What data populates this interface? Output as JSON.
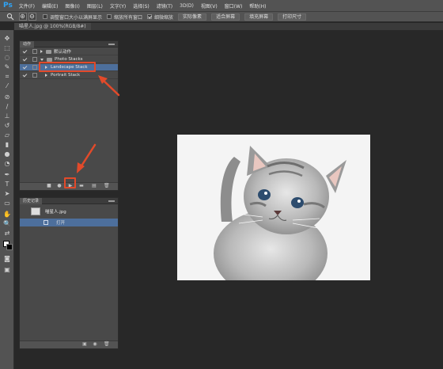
{
  "app": {
    "logo": "Ps"
  },
  "menu": [
    "文件(F)",
    "编辑(E)",
    "图像(I)",
    "图层(L)",
    "文字(Y)",
    "选择(S)",
    "滤镜(T)",
    "3D(D)",
    "视图(V)",
    "窗口(W)",
    "帮助(H)"
  ],
  "options": {
    "check1": "调整窗口大小以满屏显示",
    "check2": "缩放所有窗口",
    "check3": "细微缩放",
    "btn1": "实际像素",
    "btn2": "适合屏幕",
    "btn3": "填充屏幕",
    "btn4": "打印尺寸"
  },
  "document": {
    "tab": "喵星人.jpg @ 100%(RGB/8#)"
  },
  "actions_panel": {
    "tab": "动作",
    "rows": [
      {
        "label": "默认动作"
      },
      {
        "label": "Photo Stacks"
      },
      {
        "label": "Landscape Stack"
      },
      {
        "label": "Portrait Stack"
      }
    ]
  },
  "history_panel": {
    "tab": "历史记录",
    "snapshot": "喵星人.jpg",
    "step": "打开"
  },
  "colors": {
    "accent_red": "#e24a2a",
    "selection": "#4d6f9c",
    "ps_blue": "#2fa3f5"
  }
}
